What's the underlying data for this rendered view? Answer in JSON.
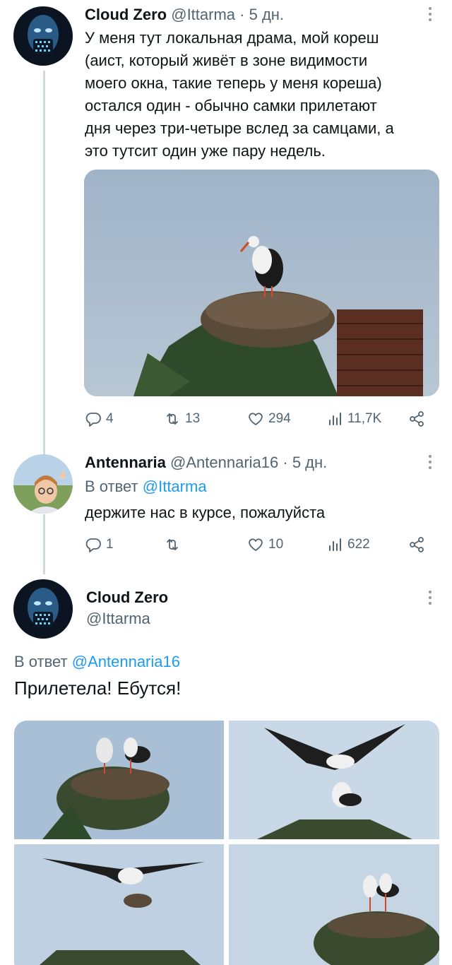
{
  "tweet1": {
    "name": "Cloud Zero",
    "handle": "@Ittarma",
    "time": "· 5 дн.",
    "lines": [
      "У меня тут локальная драма, мой кореш",
      "(аист, который живёт в зоне видимости",
      "моего окна, такие теперь у меня кореша)",
      "остался один - обычно самки прилетают",
      "дня через три-четыре вслед за самцами, а",
      "это тутсит один уже пару недель."
    ],
    "replies": "4",
    "retweets": "13",
    "likes": "294",
    "views": "11,7K"
  },
  "tweet2": {
    "name": "Antennaria",
    "handle": "@Antennaria16",
    "time": "· 5 дн.",
    "reply_prefix": "В ответ",
    "reply_handle": "@Ittarma",
    "text": "держите нас в курсе, пожалуйста",
    "replies": "1",
    "retweets": "",
    "likes": "10",
    "views": "622"
  },
  "tweet3": {
    "name": "Cloud Zero",
    "handle": "@Ittarma",
    "reply_prefix": "В ответ",
    "reply_handle": "@Antennaria16",
    "text": "Прилетела! Ебутся!"
  },
  "icons": {
    "reply": "reply-icon",
    "retweet": "retweet-icon",
    "like": "heart-icon",
    "views": "views-icon",
    "share": "share-icon",
    "more": "more-icon"
  },
  "colors": {
    "accent": "#1d9bf0",
    "secondary_text": "#536471",
    "thread_line": "#cfd9de"
  }
}
